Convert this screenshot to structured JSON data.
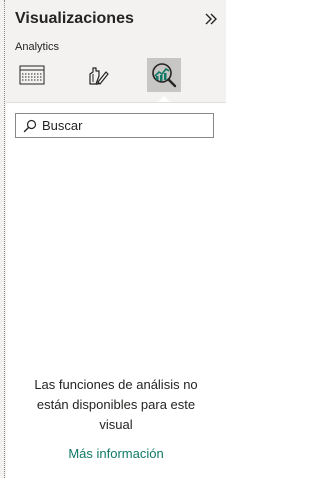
{
  "pane": {
    "title": "Visualizaciones",
    "section_label": "Analytics",
    "tabs": [
      {
        "name": "build-visual",
        "icon": "table-grid-icon",
        "active": false
      },
      {
        "name": "format",
        "icon": "paintbrush-icon",
        "active": false
      },
      {
        "name": "analytics",
        "icon": "analytics-magnifier-icon",
        "active": true
      }
    ]
  },
  "search": {
    "placeholder": "Buscar",
    "value": ""
  },
  "message": {
    "lines": [
      "Las funciones de análisis no",
      "están disponibles para este",
      "visual"
    ]
  },
  "link": {
    "label": "Más información",
    "color": "#117865"
  },
  "colors": {
    "header_bg": "#f3f2f1",
    "active_tab_bg": "#c8c6c4",
    "accent_green": "#117865"
  }
}
